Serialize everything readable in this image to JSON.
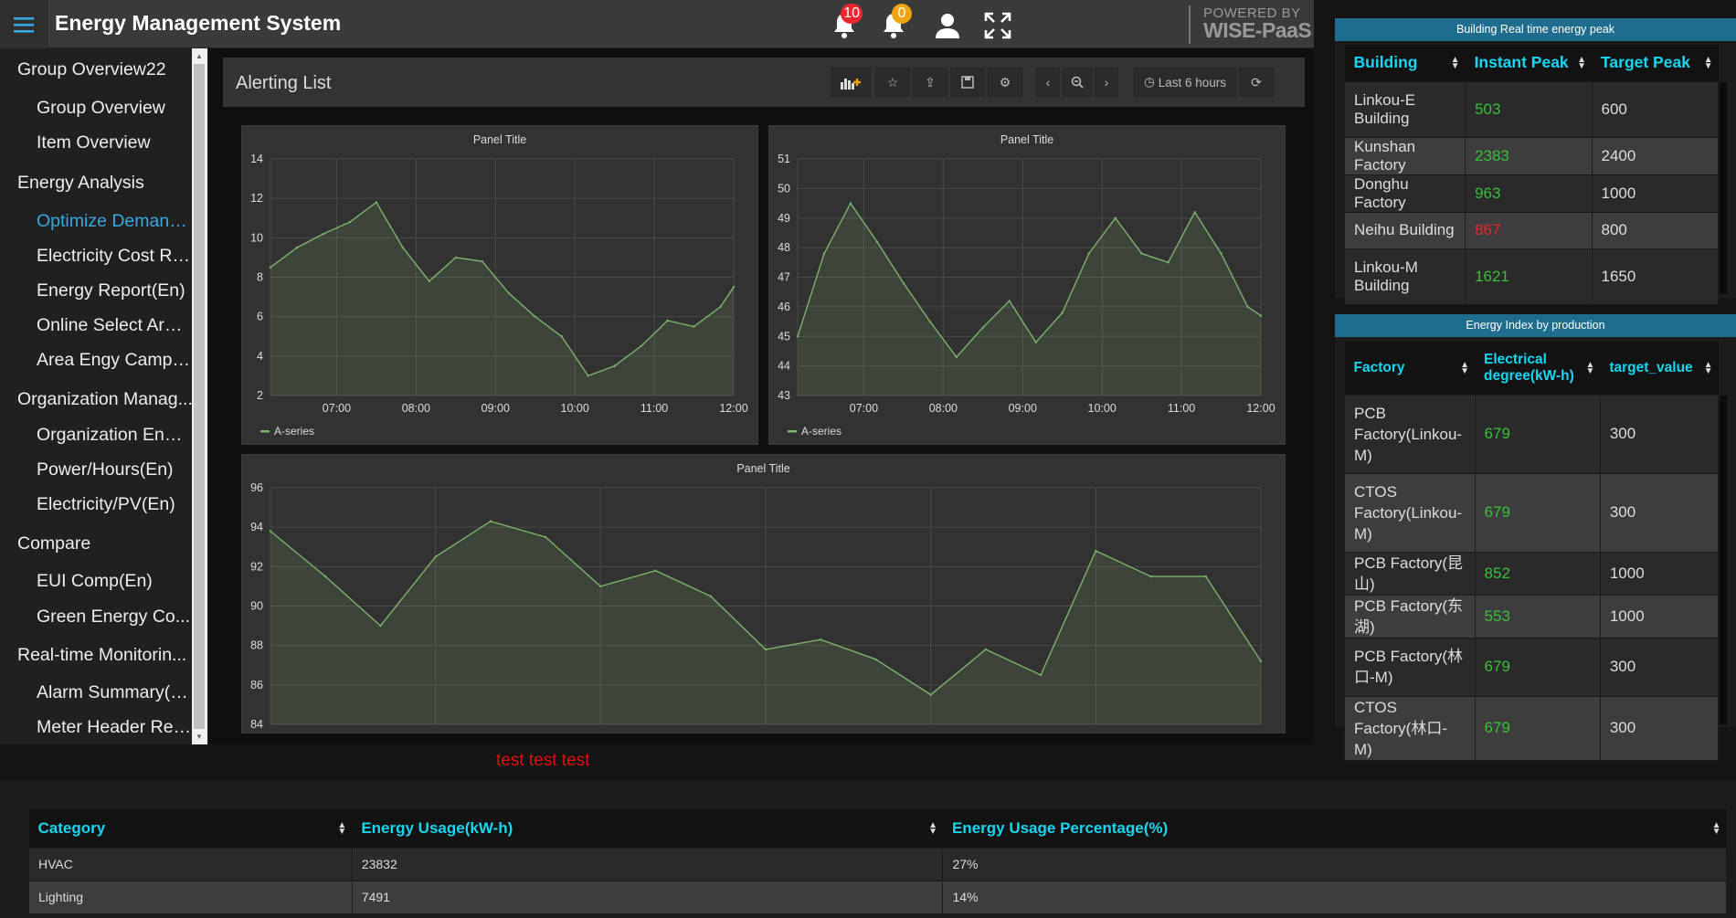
{
  "app": {
    "title": "Energy Management System",
    "notifications": {
      "alarm_count": "10",
      "alert_count": "0"
    },
    "powered_by": {
      "line1": "POWERED BY",
      "line2": "WISE-PaaS"
    }
  },
  "sidebar": {
    "items": [
      {
        "label": "Group Overview22",
        "level": "group",
        "active": false
      },
      {
        "label": "Group Overview",
        "level": "sub",
        "active": false
      },
      {
        "label": "Item Overview",
        "level": "sub",
        "active": false
      },
      {
        "label": "Energy Analysis",
        "level": "group",
        "active": false
      },
      {
        "label": "Optimize Demand...",
        "level": "sub",
        "active": true
      },
      {
        "label": "Electricity Cost Re...",
        "level": "sub",
        "active": false
      },
      {
        "label": "Energy Report(En)",
        "level": "sub",
        "active": false
      },
      {
        "label": "Online Select Area...",
        "level": "sub",
        "active": false
      },
      {
        "label": "Area Engy Camp(E...",
        "level": "sub",
        "active": false
      },
      {
        "label": "Organization Manag...",
        "level": "group",
        "active": false
      },
      {
        "label": "Organization Ener...",
        "level": "sub",
        "active": false
      },
      {
        "label": "Power/Hours(En)",
        "level": "sub",
        "active": false
      },
      {
        "label": "Electricity/PV(En)",
        "level": "sub",
        "active": false
      },
      {
        "label": "Compare",
        "level": "group",
        "active": false
      },
      {
        "label": "EUI Comp(En)",
        "level": "sub",
        "active": false
      },
      {
        "label": "Green Energy Co...",
        "level": "sub",
        "active": false
      },
      {
        "label": "Real-time Monitorin...",
        "level": "group",
        "active": false
      },
      {
        "label": "Alarm Summary(En)",
        "level": "sub",
        "active": false
      },
      {
        "label": "Meter Header Rep...",
        "level": "sub",
        "active": false
      }
    ]
  },
  "dashboard": {
    "title": "Alerting List",
    "time_range": "Last 6 hours",
    "note": "test test test"
  },
  "chart_data": [
    {
      "type": "line",
      "title": "Panel Title",
      "x_ticks": [
        "07:00",
        "08:00",
        "09:00",
        "10:00",
        "11:00",
        "12:00"
      ],
      "y_ticks": [
        2,
        4,
        6,
        8,
        10,
        12,
        14
      ],
      "ylim": [
        2,
        14
      ],
      "grid": true,
      "legend": "bottom-left",
      "series": [
        {
          "name": "A-series",
          "color": "#7eb26d",
          "x": [
            "06:10",
            "06:30",
            "06:50",
            "07:10",
            "07:30",
            "07:50",
            "08:10",
            "08:30",
            "08:50",
            "09:10",
            "09:30",
            "09:50",
            "10:10",
            "10:30",
            "10:50",
            "11:10",
            "11:30",
            "11:50",
            "12:00"
          ],
          "values": [
            8.5,
            9.5,
            10.2,
            10.8,
            11.8,
            9.5,
            7.8,
            9.0,
            8.8,
            7.2,
            6.0,
            5.0,
            3.0,
            3.5,
            4.5,
            5.8,
            5.5,
            6.5,
            7.5
          ]
        }
      ]
    },
    {
      "type": "line",
      "title": "Panel Title",
      "x_ticks": [
        "07:00",
        "08:00",
        "09:00",
        "10:00",
        "11:00",
        "12:00"
      ],
      "y_ticks": [
        43,
        44,
        45,
        46,
        47,
        48,
        49,
        50,
        51
      ],
      "ylim": [
        43,
        51
      ],
      "grid": true,
      "legend": "bottom-left",
      "series": [
        {
          "name": "A-series",
          "color": "#7eb26d",
          "x": [
            "06:10",
            "06:30",
            "06:50",
            "07:10",
            "07:30",
            "07:50",
            "08:10",
            "08:30",
            "08:50",
            "09:10",
            "09:30",
            "09:50",
            "10:10",
            "10:30",
            "10:50",
            "11:10",
            "11:30",
            "11:50",
            "12:00"
          ],
          "values": [
            45.0,
            47.8,
            49.5,
            48.2,
            46.8,
            45.5,
            44.3,
            45.3,
            46.2,
            44.8,
            45.8,
            47.8,
            49.0,
            47.8,
            47.5,
            49.2,
            47.8,
            46.0,
            45.7
          ]
        }
      ]
    },
    {
      "type": "line",
      "title": "Panel Title",
      "y_ticks": [
        84,
        86,
        88,
        90,
        92,
        94,
        96
      ],
      "ylim": [
        84,
        96
      ],
      "grid": true,
      "series": [
        {
          "color": "#7eb26d",
          "x": [
            "06:00",
            "06:20",
            "06:40",
            "07:00",
            "07:20",
            "07:40",
            "08:00",
            "08:20",
            "08:40",
            "09:00",
            "09:20",
            "09:40",
            "10:00",
            "10:20",
            "10:40",
            "11:00",
            "11:20",
            "11:40",
            "12:00"
          ],
          "values": [
            93.8,
            91.5,
            89.0,
            92.5,
            94.3,
            93.5,
            91.0,
            91.8,
            90.5,
            87.8,
            88.3,
            87.3,
            85.5,
            87.8,
            86.5,
            92.8,
            91.5,
            91.5,
            87.2
          ]
        }
      ]
    }
  ],
  "building_peak": {
    "title": "Building Real time energy peak",
    "columns": [
      "Building",
      "Instant Peak",
      "Target Peak"
    ],
    "rows": [
      {
        "name": "Linkou-E Building",
        "instant": "503",
        "target": "600",
        "status": "ok"
      },
      {
        "name": "Kunshan Factory",
        "instant": "2383",
        "target": "2400",
        "status": "ok"
      },
      {
        "name": "Donghu Factory",
        "instant": "963",
        "target": "1000",
        "status": "ok"
      },
      {
        "name": "Neihu Building",
        "instant": "867",
        "target": "800",
        "status": "over"
      },
      {
        "name": "Linkou-M Building",
        "instant": "1621",
        "target": "1650",
        "status": "ok"
      }
    ],
    "colors": {
      "ok": "#3bbf3b",
      "over": "#e8262e"
    }
  },
  "energy_index": {
    "title": "Energy Index by production",
    "columns": [
      "Factory",
      "Electrical degree(kW-h)",
      "target_value"
    ],
    "rows": [
      {
        "name": "PCB Factory(Linkou-M)",
        "degree": "679",
        "target": "300"
      },
      {
        "name": "CTOS Factory(Linkou-M)",
        "degree": "679",
        "target": "300"
      },
      {
        "name": "PCB Factory(昆山)",
        "degree": "852",
        "target": "1000"
      },
      {
        "name": "PCB Factory(东湖)",
        "degree": "553",
        "target": "1000"
      },
      {
        "name": "PCB Factory(林口-M)",
        "degree": "679",
        "target": "300"
      },
      {
        "name": "CTOS Factory(林口-M)",
        "degree": "679",
        "target": "300"
      }
    ]
  },
  "usage": {
    "columns": [
      "Category",
      "Energy Usage(kW-h)",
      "Energy Usage Percentage(%)"
    ],
    "rows": [
      {
        "category": "HVAC",
        "usage": "23832",
        "pct": "27%"
      },
      {
        "category": "Lighting",
        "usage": "7491",
        "pct": "14%"
      }
    ]
  }
}
